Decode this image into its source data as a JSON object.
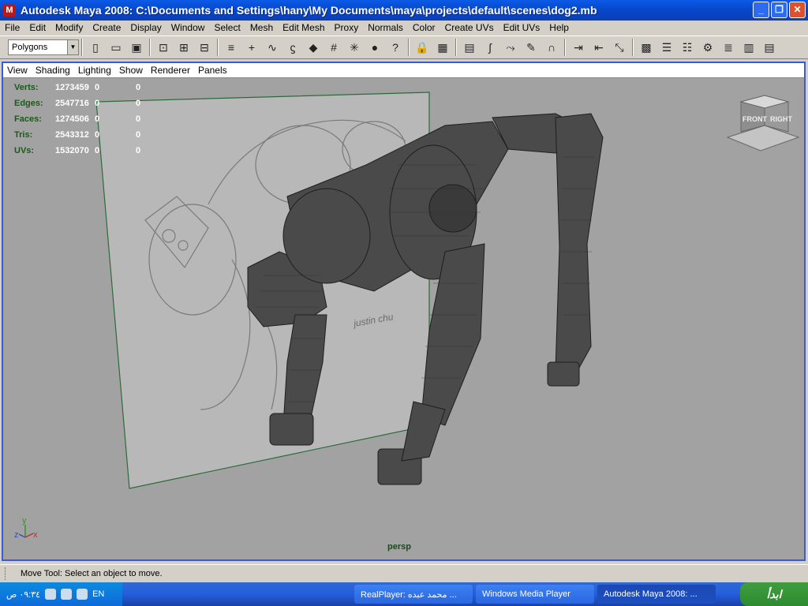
{
  "window": {
    "title": "Autodesk Maya 2008: C:\\Documents and Settings\\hany\\My Documents\\maya\\projects\\default\\scenes\\dog2.mb",
    "app_icon": "M",
    "buttons": [
      "_",
      "❐",
      "✕"
    ]
  },
  "menubar": {
    "items": [
      "File",
      "Edit",
      "Modify",
      "Create",
      "Display",
      "Window",
      "Select",
      "Mesh",
      "Edit Mesh",
      "Proxy",
      "Normals",
      "Color",
      "Create UVs",
      "Edit UVs",
      "Help"
    ]
  },
  "toolbar": {
    "mode": "Polygons"
  },
  "panel": {
    "menus": [
      "View",
      "Shading",
      "Lighting",
      "Show",
      "Renderer",
      "Panels"
    ]
  },
  "hud": {
    "rows": [
      {
        "label": "Verts:",
        "v1": "1273459",
        "v2": "0",
        "v3": "0"
      },
      {
        "label": "Edges:",
        "v1": "2547716",
        "v2": "0",
        "v3": "0"
      },
      {
        "label": "Faces:",
        "v1": "1274506",
        "v2": "0",
        "v3": "0"
      },
      {
        "label": "Tris:",
        "v1": "2543312",
        "v2": "0",
        "v3": "0"
      },
      {
        "label": "UVs:",
        "v1": "1532070",
        "v2": "0",
        "v3": "0"
      }
    ]
  },
  "viewcube": {
    "front": "FRONT",
    "right": "RIGHT"
  },
  "axes": {
    "y": "y",
    "z": "z",
    "x": "x"
  },
  "camera_label": "persp",
  "status": "Move Tool: Select an object to move.",
  "taskbar": {
    "clock": "٠٩:٣٤ ص",
    "lang": "EN",
    "tasks": [
      "RealPlayer: محمد عبده ...",
      "Windows Media Player",
      "Autodesk Maya 2008: ..."
    ],
    "start": "ابدأ"
  },
  "colors": {
    "accent": "#0a5ae6",
    "viewport": "#a2a2a2",
    "hud_label": "#1a5a1a"
  }
}
